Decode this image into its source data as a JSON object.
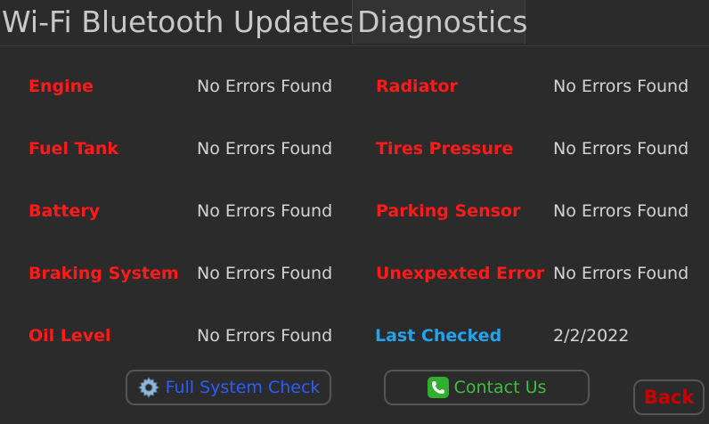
{
  "tabs": {
    "plain": "Wi-Fi Bluetooth Updates",
    "active": "Diagnostics"
  },
  "rows": [
    {
      "left_label": "Engine",
      "left_value": "No Errors Found",
      "right_label": "Radiator",
      "right_value": "No Errors Found"
    },
    {
      "left_label": "Fuel Tank",
      "left_value": "No Errors Found",
      "right_label": "Tires Pressure",
      "right_value": "No Errors Found"
    },
    {
      "left_label": "Battery",
      "left_value": "No Errors Found",
      "right_label": "Parking Sensor",
      "right_value": "No Errors Found"
    },
    {
      "left_label": "Braking System",
      "left_value": "No Errors Found",
      "right_label": "Unexpexted Error",
      "right_value": "No Errors Found"
    },
    {
      "left_label": "Oil Level",
      "left_value": "No Errors Found",
      "right_label": "Last Checked",
      "right_value": "2/2/2022"
    }
  ],
  "buttons": {
    "full_system_check": "Full System Check",
    "contact_us": "Contact Us",
    "back": "Back"
  },
  "icons": {
    "full_system_check": "gear-icon",
    "contact_us": "phone-icon"
  },
  "colors": {
    "label_red": "#ff1a1a",
    "last_checked_blue": "#22a3ef",
    "full_check_blue": "#2c5cff",
    "contact_green": "#3fbf3f",
    "back_red": "#cc0000"
  }
}
